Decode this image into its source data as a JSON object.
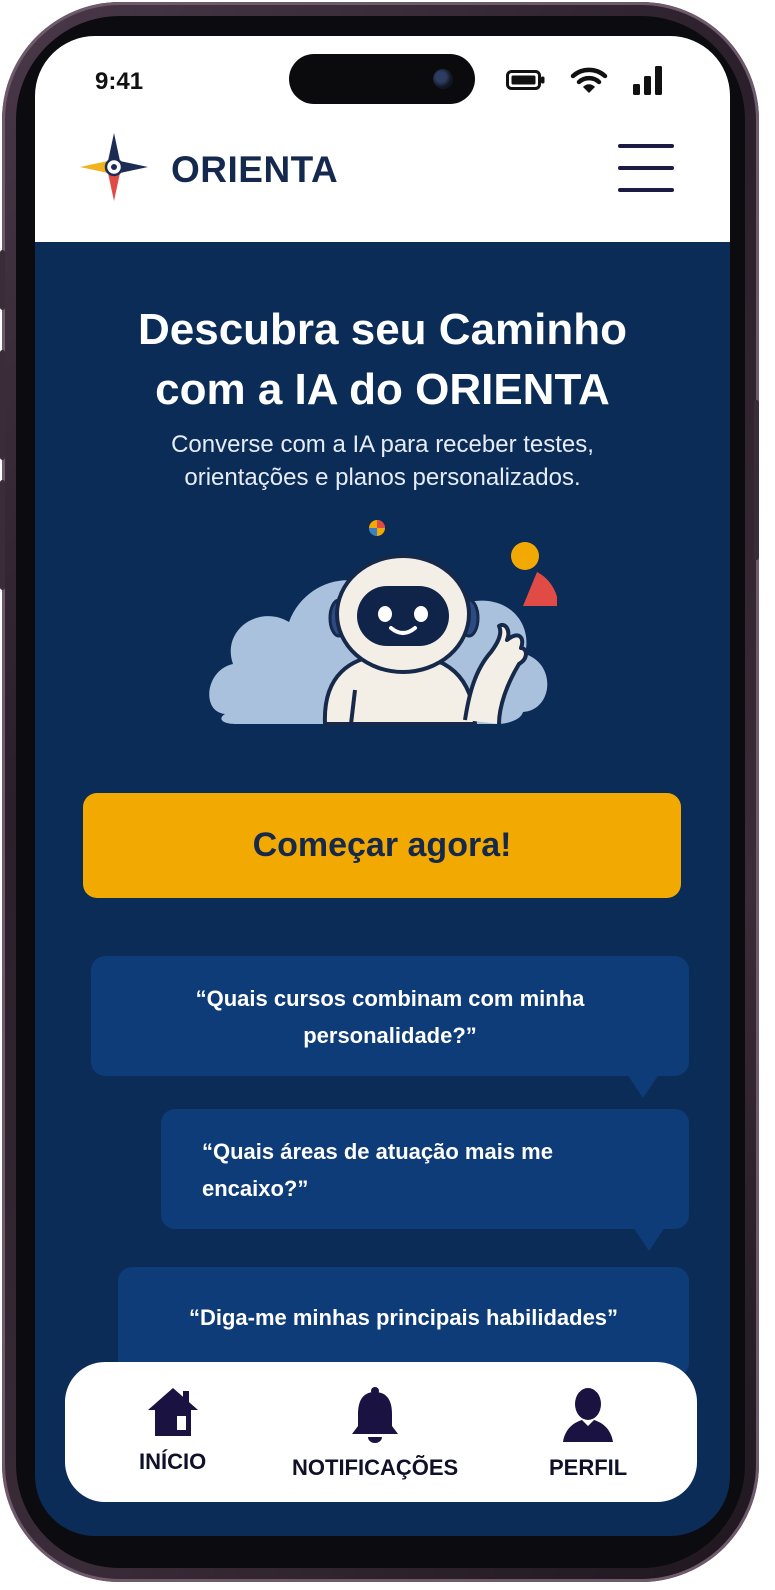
{
  "status_bar": {
    "time": "9:41"
  },
  "header": {
    "brand_name": "ORIENTA"
  },
  "hero": {
    "title_line1": "Descubra seu Caminho",
    "title_line2": "com a IA do ORIENTA",
    "subtitle_line1": "Converse com a IA para receber testes,",
    "subtitle_line2": "orientações e planos personalizados."
  },
  "cta": {
    "label": "Começar agora!"
  },
  "prompts": [
    {
      "line1": "“Quais cursos combinam com minha",
      "line2": "personalidade?”"
    },
    {
      "line1": "“Quais áreas de atuação mais me",
      "line2": "encaixo?”"
    },
    {
      "line1": "“Diga-me minhas principais habilidades”"
    }
  ],
  "bottom_nav": [
    {
      "label": "INÍCIO",
      "icon": "home-icon"
    },
    {
      "label": "NOTIFICAÇÕES",
      "icon": "bell-icon"
    },
    {
      "label": "PERFIL",
      "icon": "user-icon"
    }
  ],
  "colors": {
    "background": "#0a2c56",
    "accent": "#f2aa03",
    "bubble": "#0e3c78",
    "brand_text": "#15294f"
  }
}
